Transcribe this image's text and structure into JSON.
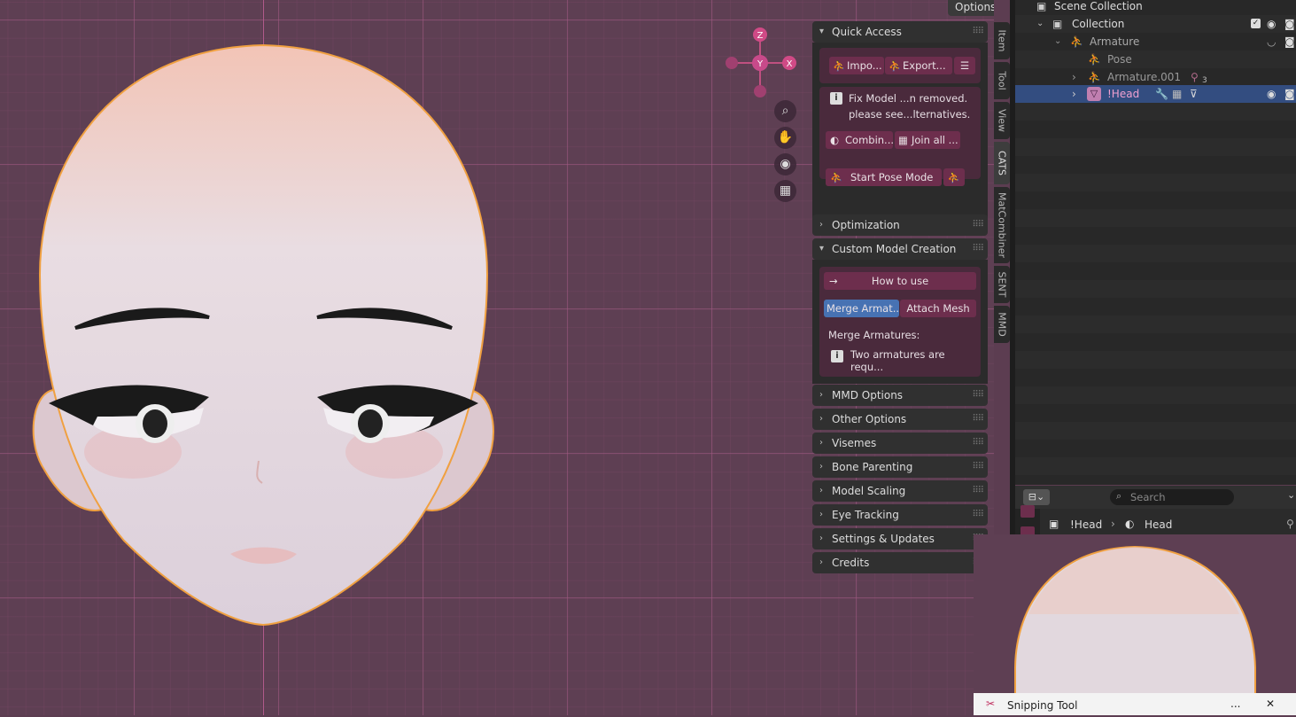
{
  "viewport": {
    "options_label": "Options",
    "gizmo": {
      "z": "Z",
      "y": "Y",
      "x": "X"
    },
    "nav_icons": [
      "zoom-icon",
      "hand-icon",
      "camera-icon",
      "grid-icon"
    ]
  },
  "npanel": {
    "quick_access": {
      "title": "Quick Access",
      "import_label": "Impo...",
      "export_label": "Export...",
      "info_line1": "Fix Model ...n removed.",
      "info_line2": "please see...lternatives.",
      "combine_label": "Combin...",
      "join_label": "Join all ...",
      "pose_mode_label": "Start Pose Mode"
    },
    "optimization": "Optimization",
    "custom_model": {
      "title": "Custom Model Creation",
      "how_to_use": "How to use",
      "merge_armatures_btn": "Merge Armat...",
      "attach_mesh_btn": "Attach Mesh",
      "merge_title": "Merge Armatures:",
      "merge_info": "Two armatures are requ..."
    },
    "collapsed": [
      "MMD Options",
      "Other Options",
      "Visemes",
      "Bone Parenting",
      "Model Scaling",
      "Eye Tracking",
      "Settings & Updates",
      "Credits"
    ]
  },
  "tabs": [
    "Item",
    "Tool",
    "View",
    "CATS",
    "MatCombiner",
    "SENT",
    "MMD"
  ],
  "outliner": {
    "scene_collection": "Scene Collection",
    "collection": "Collection",
    "armature": "Armature",
    "pose": "Pose",
    "armature_001": "Armature.001",
    "armature_001_count": "3",
    "head": "!Head"
  },
  "properties": {
    "search_placeholder": "Search",
    "breadcrumb_object": "!Head",
    "breadcrumb_data": "Head"
  },
  "snipping_tool": {
    "title": "Snipping Tool",
    "more": "...",
    "close": "✕"
  },
  "colors": {
    "viewport_bg": "#5e3f53",
    "accent_button": "#6d2e4d",
    "selected_blue": "#4772b3",
    "outline_orange": "#f0a040"
  }
}
